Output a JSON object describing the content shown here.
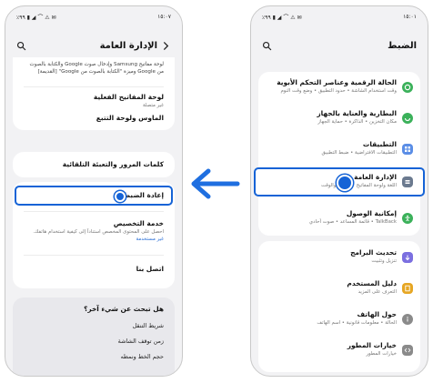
{
  "colors": {
    "accent": "#1563d6",
    "background": "#f2f2f4",
    "card": "#ffffff"
  },
  "left_phone": {
    "status_time": "١٥:٠٧",
    "status_icons": "٪٩٩ ▮ ◢ ⌒ ⚠ ✉",
    "header_title": "الإدارة العامة",
    "top_text": "لوحة مفاتيح Samsung وإدخال صوت Google والكتابة بالصوت من Google وميزة \"الكتابة بالصوت من Google\" [القديمة]",
    "items": [
      {
        "title": "لوحة المفاتيح الفعلية",
        "subtitle": "غير متصلة"
      },
      {
        "title": "الماوس ولوحة التتبع",
        "subtitle": ""
      },
      {
        "title": "كلمات المرور والتعبئة التلقائية",
        "subtitle": ""
      },
      {
        "title": "إعادة الضبط",
        "subtitle": ""
      },
      {
        "title": "خدمة التخصيص",
        "subtitle": "احصل على المحتوى المخصص استناداً إلى كيفية استخدام هاتفك.",
        "subtitle2": "غير مستخدمة"
      },
      {
        "title": "اتصل بنا",
        "subtitle": ""
      }
    ],
    "suggest": {
      "title": "هل تبحث عن شيء آخر؟",
      "items": [
        "شريط التنقل",
        "زمن توقف الشاشة",
        "حجم الخط ونمطه"
      ]
    }
  },
  "right_phone": {
    "status_time": "١٥:٠١",
    "status_icons": "٪٩٩ ▮ ◢ ⌒ ⚠ ✉",
    "header_title": "الضبط",
    "group1": [
      {
        "title": "الحالة الرقمية وعناصر التحكم الأبوية",
        "subtitle": "وقت استخدام الشاشة • حدود التطبيق • وضع وقت النوم"
      },
      {
        "title": "البطارية والعناية بالجهاز",
        "subtitle": "مكان التخزين • الذاكرة • حماية الجهاز"
      },
      {
        "title": "التطبيقات",
        "subtitle": "التطبيقات الافتراضية • ضبط التطبيق"
      },
      {
        "title": "الإدارة العامة",
        "subtitle": "اللغة ولوحة المفاتيح • التاريخ والوقت"
      },
      {
        "title": "إمكانية الوصول",
        "subtitle": "TalkBack • قائمة المساعد • صوت أحادي"
      }
    ],
    "group2": [
      {
        "title": "تحديث البرامج",
        "subtitle": "تنزيل وتثبيت"
      },
      {
        "title": "دليل المستخدم",
        "subtitle": "التعرف على المزيد"
      },
      {
        "title": "حول الهاتف",
        "subtitle": "الحالة • معلومات قانونية • اسم الهاتف"
      },
      {
        "title": "خيارات المطور",
        "subtitle": "خيارات المطور"
      }
    ]
  }
}
